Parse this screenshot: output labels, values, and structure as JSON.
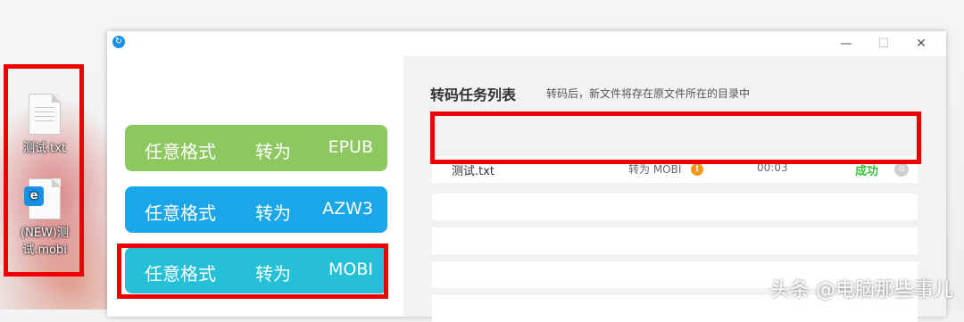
{
  "desktop": {
    "icons": [
      {
        "label": "测试.txt",
        "icon": "text-file-icon"
      },
      {
        "label": "(NEW)测试.mobi",
        "icon": "mobi-file-icon"
      }
    ]
  },
  "window": {
    "logo_glyph": "↻",
    "controls": {
      "minimize": "—",
      "maximize": "☐",
      "close": "✕"
    }
  },
  "sidebar": {
    "buttons": [
      {
        "from": "任意格式",
        "to_word": "转为",
        "format": "EPUB",
        "color": "#8dc75f"
      },
      {
        "from": "任意格式",
        "to_word": "转为",
        "format": "AZW3",
        "color": "#1aa6e8"
      },
      {
        "from": "任意格式",
        "to_word": "转为",
        "format": "MOBI",
        "color": "#25c0d8"
      }
    ]
  },
  "task_list": {
    "title": "转码任务列表",
    "hint": "转码后，新文件将存在原文件所在的目录中",
    "rows": [
      {
        "name": "测试.txt",
        "target": "转为 MOBI",
        "warn_glyph": "!",
        "time": "00:03",
        "status": "成功",
        "open_glyph": "⊙"
      }
    ]
  },
  "watermark": "头条 @电脑那些事儿",
  "colors": {
    "highlight": "#ef0000",
    "success": "#38c33a",
    "warning": "#f39a1e"
  }
}
